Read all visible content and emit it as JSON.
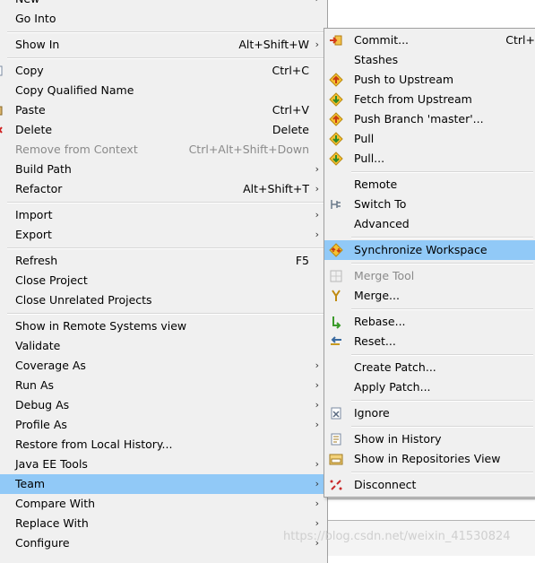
{
  "main_menu": {
    "items": [
      {
        "label": "New",
        "accel": "",
        "submenu": true
      },
      {
        "label": "Go Into",
        "accel": "",
        "submenu": false
      },
      {
        "label": "Show In",
        "accel": "Alt+Shift+W",
        "submenu": true
      },
      {
        "label": "Copy",
        "accel": "Ctrl+C",
        "submenu": false
      },
      {
        "label": "Copy Qualified Name",
        "accel": "",
        "submenu": false
      },
      {
        "label": "Paste",
        "accel": "Ctrl+V",
        "submenu": false
      },
      {
        "label": "Delete",
        "accel": "Delete",
        "submenu": false
      },
      {
        "label": "Remove from Context",
        "accel": "Ctrl+Alt+Shift+Down",
        "submenu": false,
        "disabled": true
      },
      {
        "label": "Build Path",
        "accel": "",
        "submenu": true
      },
      {
        "label": "Refactor",
        "accel": "Alt+Shift+T",
        "submenu": true
      },
      {
        "label": "Import",
        "accel": "",
        "submenu": true
      },
      {
        "label": "Export",
        "accel": "",
        "submenu": true
      },
      {
        "label": "Refresh",
        "accel": "F5",
        "submenu": false
      },
      {
        "label": "Close Project",
        "accel": "",
        "submenu": false
      },
      {
        "label": "Close Unrelated Projects",
        "accel": "",
        "submenu": false
      },
      {
        "label": "Show in Remote Systems view",
        "accel": "",
        "submenu": false
      },
      {
        "label": "Validate",
        "accel": "",
        "submenu": false
      },
      {
        "label": "Coverage As",
        "accel": "",
        "submenu": true
      },
      {
        "label": "Run As",
        "accel": "",
        "submenu": true
      },
      {
        "label": "Debug As",
        "accel": "",
        "submenu": true
      },
      {
        "label": "Profile As",
        "accel": "",
        "submenu": true
      },
      {
        "label": "Restore from Local History...",
        "accel": "",
        "submenu": false
      },
      {
        "label": "Java EE Tools",
        "accel": "",
        "submenu": true
      },
      {
        "label": "Team",
        "accel": "",
        "submenu": true,
        "selected": true
      },
      {
        "label": "Compare With",
        "accel": "",
        "submenu": true
      },
      {
        "label": "Replace With",
        "accel": "",
        "submenu": true
      },
      {
        "label": "Configure",
        "accel": "",
        "submenu": true
      }
    ]
  },
  "team_submenu": {
    "items": [
      {
        "label": "Commit...",
        "accel": "Ctrl+",
        "icon": "commit-icon"
      },
      {
        "label": "Stashes",
        "accel": "",
        "icon": ""
      },
      {
        "label": "Push to Upstream",
        "accel": "",
        "icon": "push-icon"
      },
      {
        "label": "Fetch from Upstream",
        "accel": "",
        "icon": "fetch-icon"
      },
      {
        "label": "Push Branch 'master'...",
        "accel": "",
        "icon": "push-branch-icon"
      },
      {
        "label": "Pull",
        "accel": "",
        "icon": "pull-icon"
      },
      {
        "label": "Pull...",
        "accel": "",
        "icon": "pull-dialog-icon"
      },
      {
        "label": "Remote",
        "accel": "",
        "icon": ""
      },
      {
        "label": "Switch To",
        "accel": "",
        "icon": "switch-icon"
      },
      {
        "label": "Advanced",
        "accel": "",
        "icon": ""
      },
      {
        "label": "Synchronize Workspace",
        "accel": "",
        "icon": "synchronize-icon",
        "selected": true
      },
      {
        "label": "Merge Tool",
        "accel": "",
        "icon": "merge-tool-icon",
        "disabled": true
      },
      {
        "label": "Merge...",
        "accel": "",
        "icon": "merge-icon"
      },
      {
        "label": "Rebase...",
        "accel": "",
        "icon": "rebase-icon"
      },
      {
        "label": "Reset...",
        "accel": "",
        "icon": "reset-icon"
      },
      {
        "label": "Create Patch...",
        "accel": "",
        "icon": ""
      },
      {
        "label": "Apply Patch...",
        "accel": "",
        "icon": ""
      },
      {
        "label": "Ignore",
        "accel": "",
        "icon": "ignore-icon"
      },
      {
        "label": "Show in History",
        "accel": "",
        "icon": "history-icon"
      },
      {
        "label": "Show in Repositories View",
        "accel": "",
        "icon": "repositories-icon"
      },
      {
        "label": "Disconnect",
        "accel": "",
        "icon": "disconnect-icon"
      }
    ]
  },
  "watermark": "https://blog.csdn.net/weixin_41530824",
  "colors": {
    "menu_bg": "#f0f0f0",
    "selection": "#91c9f7",
    "disabled_text": "#8a8a8a"
  }
}
